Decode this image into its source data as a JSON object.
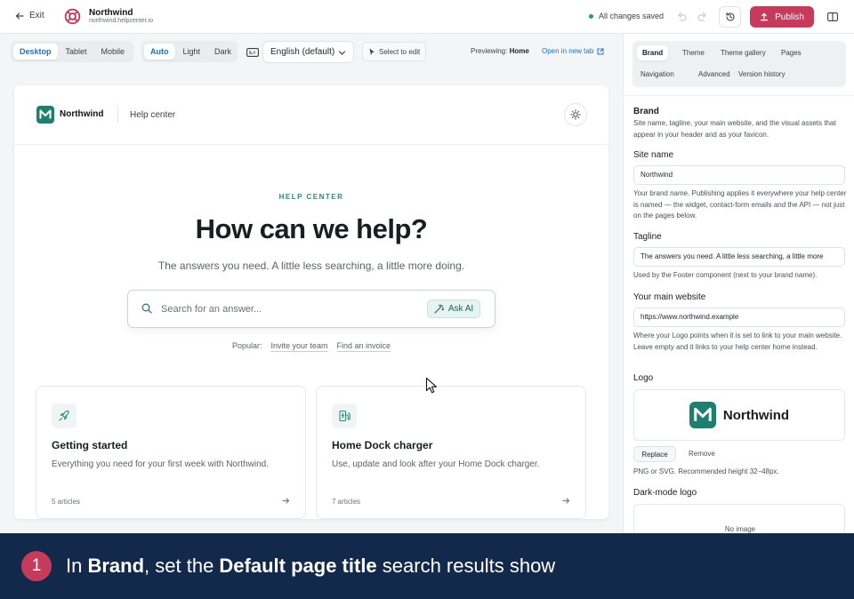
{
  "topbar": {
    "exit_label": "Exit",
    "site_name": "Northwind",
    "site_domain": "northwind.helpcenter.io",
    "save_status": "All changes saved",
    "publish_label": "Publish"
  },
  "toolbar": {
    "device_modes": [
      "Desktop",
      "Tablet",
      "Mobile"
    ],
    "active_device": "Desktop",
    "theme_modes": [
      "Auto",
      "Light",
      "Dark"
    ],
    "active_theme": "Auto",
    "language": "English (default)",
    "select_to_edit": "Select to edit",
    "previewing_label": "Previewing:",
    "previewing_page": "Home",
    "open_new_tab": "Open in new tab"
  },
  "preview": {
    "brand": "Northwind",
    "section": "Help center",
    "kicker": "HELP CENTER",
    "hero_title": "How can we help?",
    "hero_subtitle": "The answers you need. A little less searching, a little more doing.",
    "search_placeholder": "Search for an answer...",
    "ask_ai_label": "Ask AI",
    "popular_label": "Popular:",
    "popular_links": [
      "Invite your team",
      "Find an invoice"
    ],
    "cards": [
      {
        "title": "Getting started",
        "description": "Everything you need for your first week with Northwind.",
        "count": "5 articles",
        "icon": "rocket-icon"
      },
      {
        "title": "Home Dock charger",
        "description": "Use, update and look after your Home Dock charger.",
        "count": "7 articles",
        "icon": "ev-charger-icon"
      }
    ]
  },
  "panel": {
    "tabs_row1": [
      "Brand",
      "Theme",
      "Theme gallery",
      "Pages"
    ],
    "tabs_row2": [
      "Navigation",
      "Advanced",
      "Version history"
    ],
    "active_tab": "Brand",
    "section_title": "Brand",
    "section_desc": "Site name, tagline, your main website, and the visual assets that appear in your header and as your favicon.",
    "site_name_label": "Site name",
    "site_name_value": "Northwind",
    "site_name_help": "Your brand name. Publishing applies it everywhere your help center is named — the widget, contact-form emails and the API — not just on the pages below.",
    "tagline_label": "Tagline",
    "tagline_value": "The answers you need. A little less searching, a little more",
    "tagline_help": "Used by the Footer component (next to your brand name).",
    "website_label": "Your main website",
    "website_value": "https://www.northwind.example",
    "website_help": "Where your Logo points when it is set to link to your main website. Leave empty and it links to your help center home instead.",
    "logo_label": "Logo",
    "logo_name": "Northwind",
    "replace_label": "Replace",
    "remove_label": "Remove",
    "logo_help": "PNG or SVG. Recommended height 32–48px.",
    "dark_logo_label": "Dark-mode logo",
    "dark_logo_empty": "No image"
  },
  "banner": {
    "step": "1",
    "t1": "In ",
    "b1": "Brand",
    "t2": ", set the ",
    "b2": "Default page title",
    "t3": " search results show"
  },
  "colors": {
    "brand_teal": "#1f7f6e",
    "publish": "#c63a5c",
    "link_blue": "#1e6fc9",
    "banner_bg": "#13294b"
  }
}
